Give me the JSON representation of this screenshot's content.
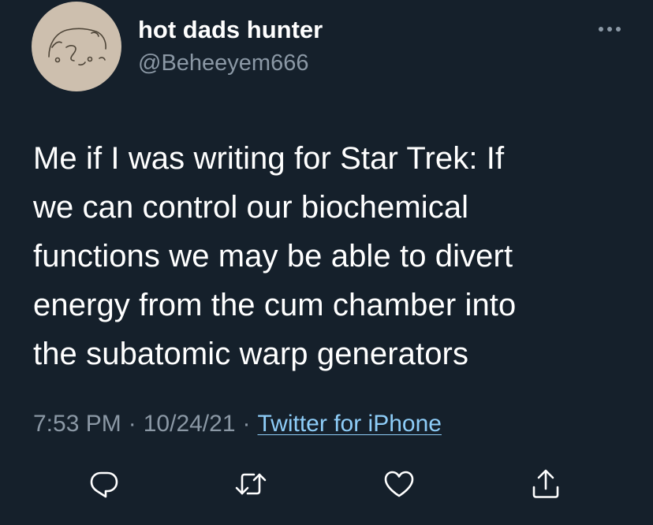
{
  "tweet": {
    "author": {
      "display_name": "hot dads hunter",
      "handle": "@Beheeyem666",
      "avatar_icon": "hand-drawn-face-avatar"
    },
    "more_icon": "more-horizontal-icon",
    "text": "Me if I was writing for Star Trek: If\nwe can control our biochemical\nfunctions we may be able to divert\nenergy from the cum chamber into\nthe subatomic warp generators",
    "time": "7:53 PM",
    "separator": "·",
    "date": "10/24/21",
    "source": "Twitter for iPhone",
    "actions": [
      {
        "name": "reply",
        "icon": "reply-icon"
      },
      {
        "name": "retweet",
        "icon": "retweet-icon"
      },
      {
        "name": "like",
        "icon": "heart-icon"
      },
      {
        "name": "share",
        "icon": "share-icon"
      }
    ]
  },
  "colors": {
    "background": "#15202b",
    "primary_text": "#ffffff",
    "secondary_text": "#8b98a5",
    "link": "#8ecdf8",
    "avatar_background": "#cdbfae"
  }
}
